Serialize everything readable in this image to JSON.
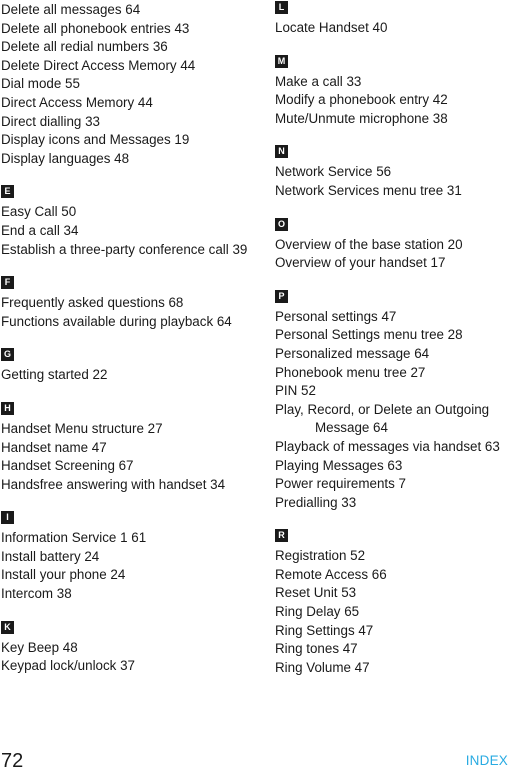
{
  "document": {
    "page_number": "72",
    "section_label": "INDEX",
    "accent_color": "#29abe2",
    "text_color": "#1a1a1a",
    "background_color": "#ffffff"
  },
  "columns": [
    {
      "name": "left-column",
      "sections": [
        {
          "letter": "",
          "entries": [
            {
              "text": "Delete all messages 64"
            },
            {
              "text": "Delete all phonebook entries 43"
            },
            {
              "text": "Delete all redial numbers 36"
            },
            {
              "text": "Delete Direct Access Memory 44"
            },
            {
              "text": "Dial mode 55"
            },
            {
              "text": "Direct Access Memory 44"
            },
            {
              "text": "Direct dialling 33"
            },
            {
              "text": "Display icons and Messages 19"
            },
            {
              "text": "Display languages 48"
            }
          ]
        },
        {
          "letter": "E",
          "entries": [
            {
              "text": "Easy Call 50"
            },
            {
              "text": "End a call 34"
            },
            {
              "text": "Establish a three-party conference call 39"
            }
          ]
        },
        {
          "letter": "F",
          "entries": [
            {
              "text": "Frequently asked questions 68"
            },
            {
              "text": "Functions available during playback 64"
            }
          ]
        },
        {
          "letter": "G",
          "entries": [
            {
              "text": "Getting started 22"
            }
          ]
        },
        {
          "letter": "H",
          "entries": [
            {
              "text": "Handset Menu structure 27"
            },
            {
              "text": "Handset name 47"
            },
            {
              "text": "Handset Screening 67"
            },
            {
              "text": "Handsfree answering with handset 34"
            }
          ]
        },
        {
          "letter": "I",
          "entries": [
            {
              "text": "Information Service 1 61"
            },
            {
              "text": "Install battery 24"
            },
            {
              "text": "Install your phone 24"
            },
            {
              "text": "Intercom 38"
            }
          ]
        },
        {
          "letter": "K",
          "entries": [
            {
              "text": "Key Beep 48"
            },
            {
              "text": "Keypad lock/unlock 37"
            }
          ]
        }
      ]
    },
    {
      "name": "right-column",
      "sections": [
        {
          "letter": "L",
          "entries": [
            {
              "text": "Locate Handset 40"
            }
          ]
        },
        {
          "letter": "M",
          "entries": [
            {
              "text": "Make a call 33"
            },
            {
              "text": "Modify a phonebook entry 42"
            },
            {
              "text": "Mute/Unmute microphone 38"
            }
          ]
        },
        {
          "letter": "N",
          "entries": [
            {
              "text": "Network Service 56"
            },
            {
              "text": "Network Services menu tree 31"
            }
          ]
        },
        {
          "letter": "O",
          "entries": [
            {
              "text": "Overview of the base station 20"
            },
            {
              "text": "Overview of your handset 17"
            }
          ]
        },
        {
          "letter": "P",
          "entries": [
            {
              "text": "Personal settings 47"
            },
            {
              "text": "Personal Settings menu tree 28"
            },
            {
              "text": "Personalized message 64"
            },
            {
              "text": "Phonebook menu tree 27"
            },
            {
              "text": "PIN 52"
            },
            {
              "text": "Play, Record, or Delete an Outgoing",
              "continuation": "Message 64"
            },
            {
              "text": "Playback of messages via handset 63"
            },
            {
              "text": "Playing Messages 63"
            },
            {
              "text": "Power requirements 7"
            },
            {
              "text": "Predialling 33"
            }
          ]
        },
        {
          "letter": "R",
          "entries": [
            {
              "text": "Registration 52"
            },
            {
              "text": "Remote Access 66"
            },
            {
              "text": "Reset Unit 53"
            },
            {
              "text": "Ring Delay 65"
            },
            {
              "text": "Ring Settings 47"
            },
            {
              "text": "Ring tones 47"
            },
            {
              "text": "Ring Volume 47"
            }
          ]
        }
      ]
    }
  ]
}
